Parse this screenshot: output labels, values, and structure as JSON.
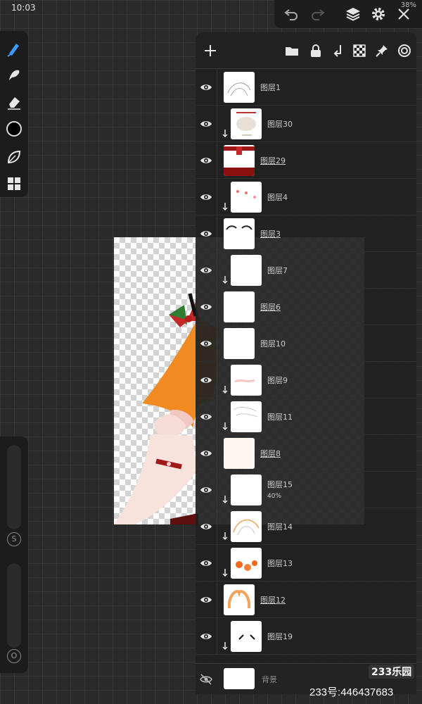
{
  "status_bar": {
    "time": "10:03",
    "battery": "38%"
  },
  "toolbar_top": {
    "icons": [
      "undo-icon",
      "redo-icon",
      "layers-icon",
      "settings-icon",
      "close-icon"
    ]
  },
  "left_toolbar": {
    "tools": [
      "brush-icon",
      "smudge-icon",
      "eraser-icon",
      "color-swatch",
      "leaf-icon",
      "grid-icon"
    ],
    "current_color": "#000000",
    "size_label": "S",
    "opacity_label": "O"
  },
  "layers_panel": {
    "toolbar_icons": [
      "add-layer-icon",
      "folder-icon",
      "lock-icon",
      "merge-down-icon",
      "checker-icon",
      "pin-icon",
      "reference-icon"
    ],
    "layers": [
      {
        "name": "图层1",
        "clipped": false,
        "underline": false
      },
      {
        "name": "图层30",
        "clipped": true,
        "underline": false
      },
      {
        "name": "图层29",
        "clipped": false,
        "underline": true
      },
      {
        "name": "图层4",
        "clipped": true,
        "underline": false
      },
      {
        "name": "图层3",
        "clipped": false,
        "underline": true
      },
      {
        "name": "图层7",
        "clipped": true,
        "underline": false
      },
      {
        "name": "图层6",
        "clipped": false,
        "underline": true
      },
      {
        "name": "图层10",
        "clipped": false,
        "underline": false
      },
      {
        "name": "图层9",
        "clipped": true,
        "underline": false
      },
      {
        "name": "图层11",
        "clipped": true,
        "underline": false
      },
      {
        "name": "图层8",
        "clipped": false,
        "underline": true
      },
      {
        "name": "图层15",
        "clipped": true,
        "underline": false,
        "opacity": "40%"
      },
      {
        "name": "图层14",
        "clipped": true,
        "underline": false
      },
      {
        "name": "图层13",
        "clipped": true,
        "underline": false
      },
      {
        "name": "图层12",
        "clipped": false,
        "underline": true
      },
      {
        "name": "图层19",
        "clipped": true,
        "underline": false
      }
    ],
    "background_layer": {
      "name": "背景",
      "visible": false
    }
  },
  "watermark": {
    "logo": "233乐园",
    "id": "233号:446437683"
  }
}
